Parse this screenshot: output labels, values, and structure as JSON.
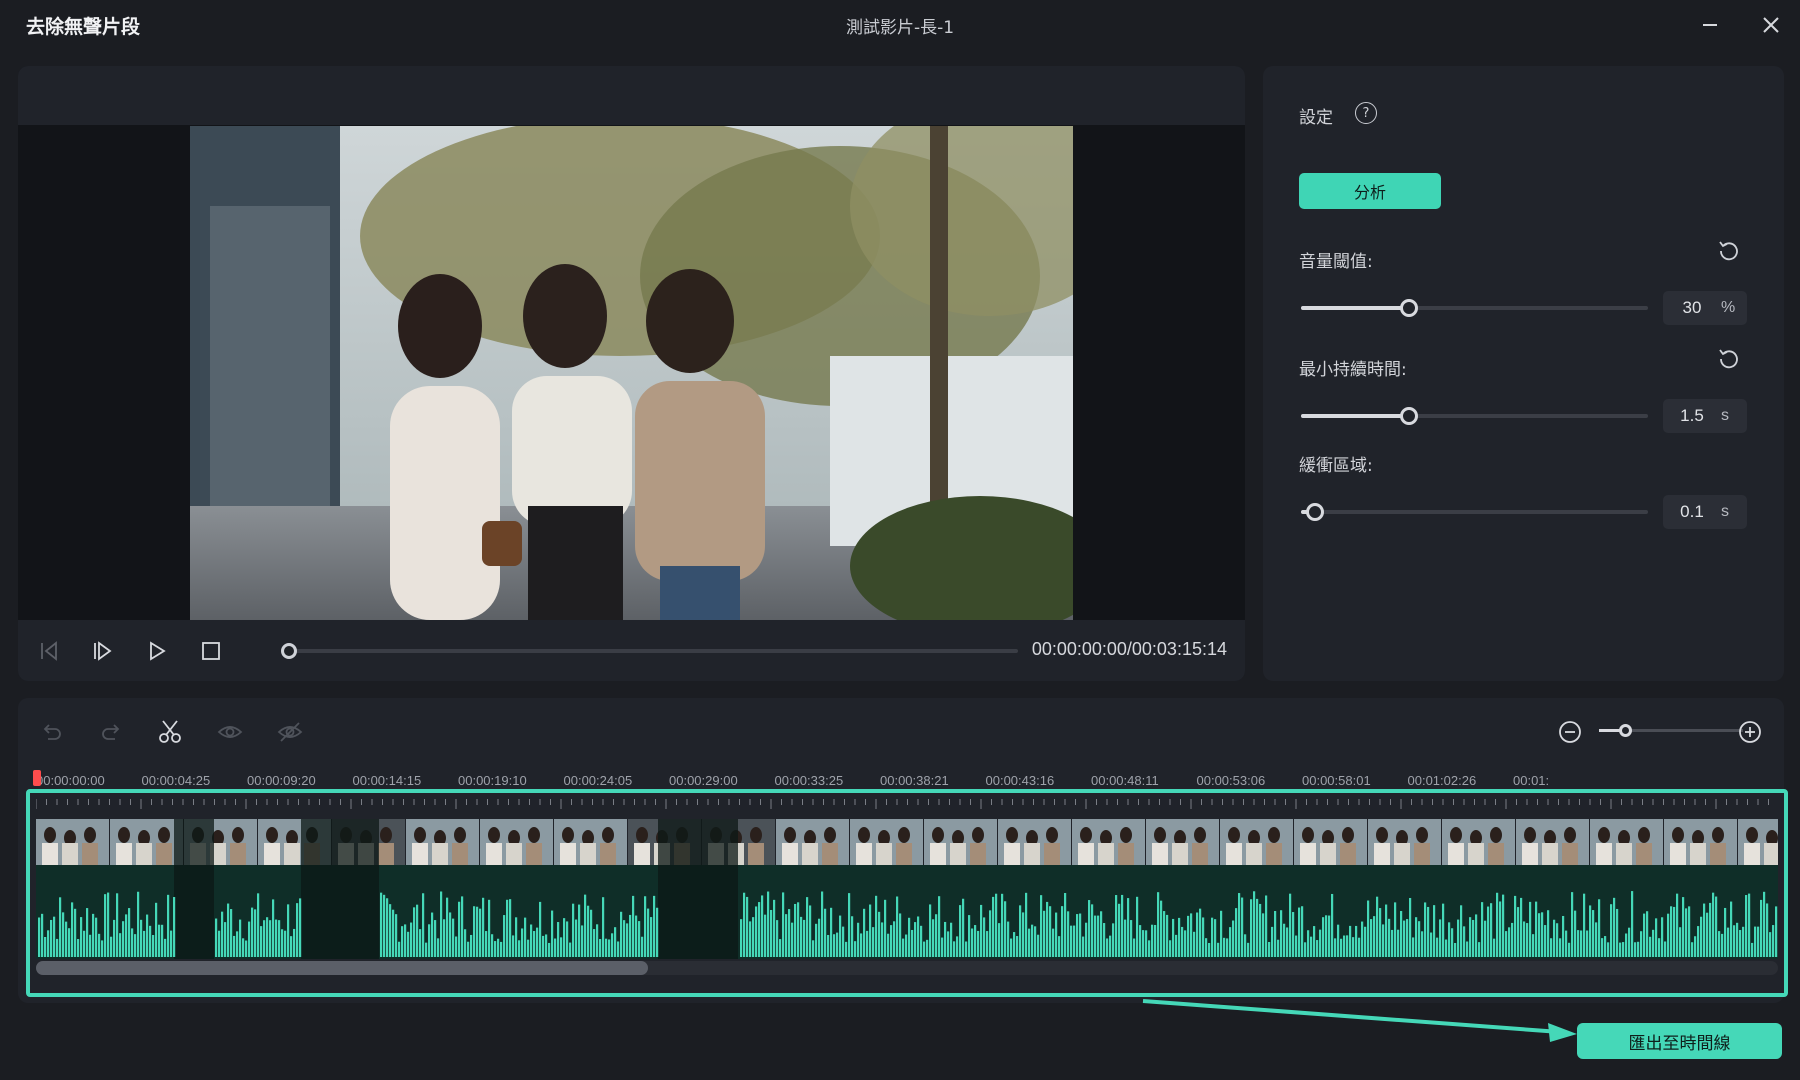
{
  "window": {
    "app_title": "去除無聲片段",
    "document_title": "測試影片-長-1",
    "minimize_icon": "minimize-icon",
    "close_icon": "close-icon"
  },
  "player": {
    "timecode": "00:00:00:00/00:03:15:14",
    "progress": 0,
    "controls": [
      "prev-frame-icon",
      "next-frame-icon",
      "play-icon",
      "stop-icon"
    ]
  },
  "settings": {
    "title": "設定",
    "help_glyph": "?",
    "analyze_label": "分析",
    "params": [
      {
        "label": "音量閾值:",
        "value": "30",
        "unit": "%",
        "level": 0.31,
        "has_reset": true
      },
      {
        "label": "最小持續時間:",
        "value": "1.5",
        "unit": "s",
        "level": 0.31,
        "has_reset": true
      },
      {
        "label": "緩衝區域:",
        "value": "0.1",
        "unit": "s",
        "level": 0.04,
        "has_reset": false
      }
    ]
  },
  "timeline": {
    "tools": [
      "undo-icon",
      "redo-icon",
      "scissors-icon",
      "eye-icon",
      "eye-off-icon"
    ],
    "zoom_level": 0.17,
    "ruler_labels": [
      "00:00:00:00",
      "00:00:04:25",
      "00:00:09:20",
      "00:00:14:15",
      "00:00:19:10",
      "00:00:24:05",
      "00:00:29:00",
      "00:00:33:25",
      "00:00:38:21",
      "00:00:43:16",
      "00:00:48:11",
      "00:00:53:06",
      "00:00:58:01",
      "00:01:02:26",
      "00:01:"
    ],
    "scroll_position": 0
  },
  "export": {
    "label": "匯出至時間線"
  },
  "colors": {
    "accent": "#45d8b8",
    "panel": "#20232a",
    "background": "#1b1d22",
    "playhead": "#ff4d4d"
  }
}
